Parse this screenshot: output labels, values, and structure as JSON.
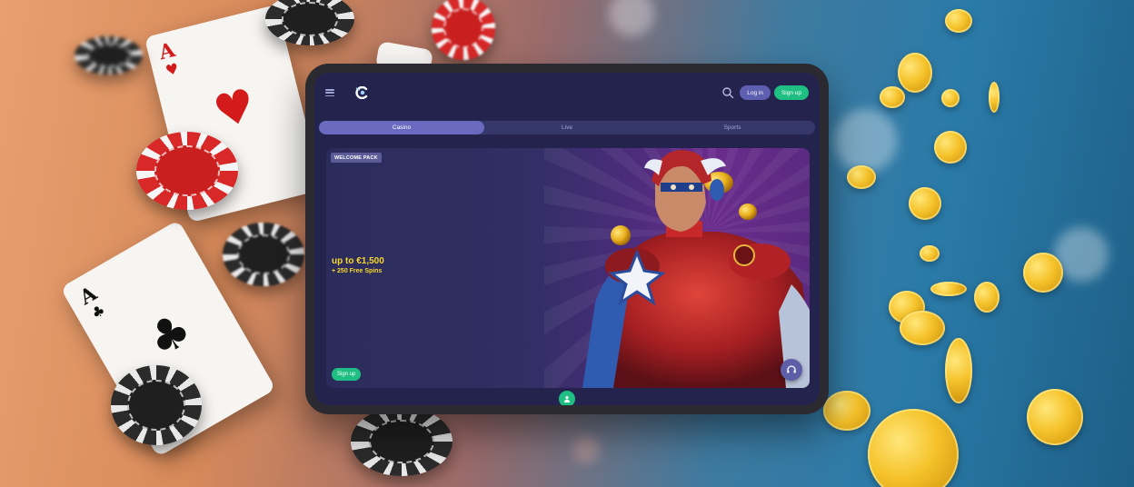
{
  "header": {
    "menu_icon": "hamburger-menu-icon",
    "logo_icon": "casino-logo-icon",
    "search_icon": "search-icon",
    "login_label": "Log in",
    "signup_label": "Sign up"
  },
  "tabs": [
    {
      "label": "Casino",
      "active": true
    },
    {
      "label": "Live",
      "active": false
    },
    {
      "label": "Sports",
      "active": false
    }
  ],
  "banner": {
    "badge": "WELCOME PACK",
    "headline": "up to €1,500",
    "subline": "+ 250 Free Spins",
    "cta_label": "Sign up"
  },
  "support_icon": "headset-support-icon",
  "colors": {
    "accent_green": "#1fbf84",
    "accent_purple": "#5e5fb0",
    "bg_navy": "#23234d",
    "promo_yellow": "#f8d62a"
  }
}
